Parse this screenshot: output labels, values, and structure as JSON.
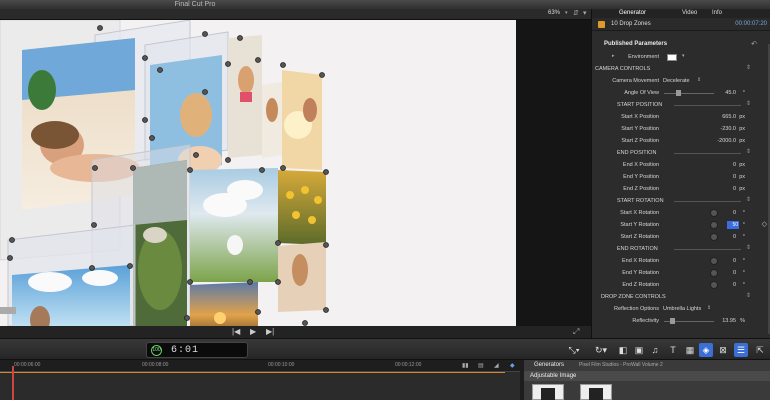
{
  "app": {
    "title": "Final Cut Pro"
  },
  "viewer": {
    "zoom": "63%"
  },
  "inspector": {
    "tabs": [
      "Generator",
      "Video",
      "Info"
    ],
    "active_tab": "Generator",
    "clip_name": "10 Drop Zones",
    "clip_time": "00:00:07:20",
    "published_label": "Published Parameters",
    "rows": {
      "environment": "Environment",
      "camera_controls": "CAMERA CONTROLS",
      "camera_movement": "Camera Movement",
      "camera_movement_value": "Decelerate",
      "angle_of_view": "Angle Of View",
      "angle_of_view_value": "45.0",
      "start_position": "START POSITION",
      "start_x_position": "Start X Position",
      "start_x_position_value": "665.0",
      "start_y_position": "Start Y Position",
      "start_y_position_value": "-230.0",
      "start_z_position": "Start Z Position",
      "start_z_position_value": "-2000.0",
      "end_position": "END POSITION",
      "end_x_position": "End X Position",
      "end_x_position_value": "0",
      "end_y_position": "End Y Position",
      "end_y_position_value": "0",
      "end_z_position": "End Z Position",
      "end_z_position_value": "0",
      "start_rotation": "START ROTATION",
      "start_x_rotation": "Start X Rotation",
      "start_x_rotation_value": "0",
      "start_y_rotation": "Start Y Rotation",
      "start_y_rotation_value": "50",
      "start_z_rotation": "Start Z Rotation",
      "start_z_rotation_value": "0",
      "end_rotation": "END ROTATION",
      "end_x_rotation": "End X Rotation",
      "end_x_rotation_value": "0",
      "end_y_rotation": "End Y Rotation",
      "end_y_rotation_value": "0",
      "end_z_rotation": "End Z Rotation",
      "end_z_rotation_value": "0",
      "drop_zone_controls": "DROP ZONE CONTROLS",
      "reflection_options": "Reflection Options",
      "reflection_options_value": "Umbrella Lights",
      "reflectivity": "Reflectivity",
      "reflectivity_value": "13.95",
      "px": "px",
      "deg": "°",
      "pct": "%"
    }
  },
  "toolbar": {
    "timecode": "6:01",
    "timecode_prefix": "100"
  },
  "timeline": {
    "ruler": [
      "00:00:06:00",
      "00:00:08:00",
      "00:00:10:00",
      "00:00:12:00"
    ]
  },
  "generators": {
    "title": "Generators",
    "path": "Pixel Film Studios - ProWall Volume 2",
    "section": "Adjustable Image"
  }
}
